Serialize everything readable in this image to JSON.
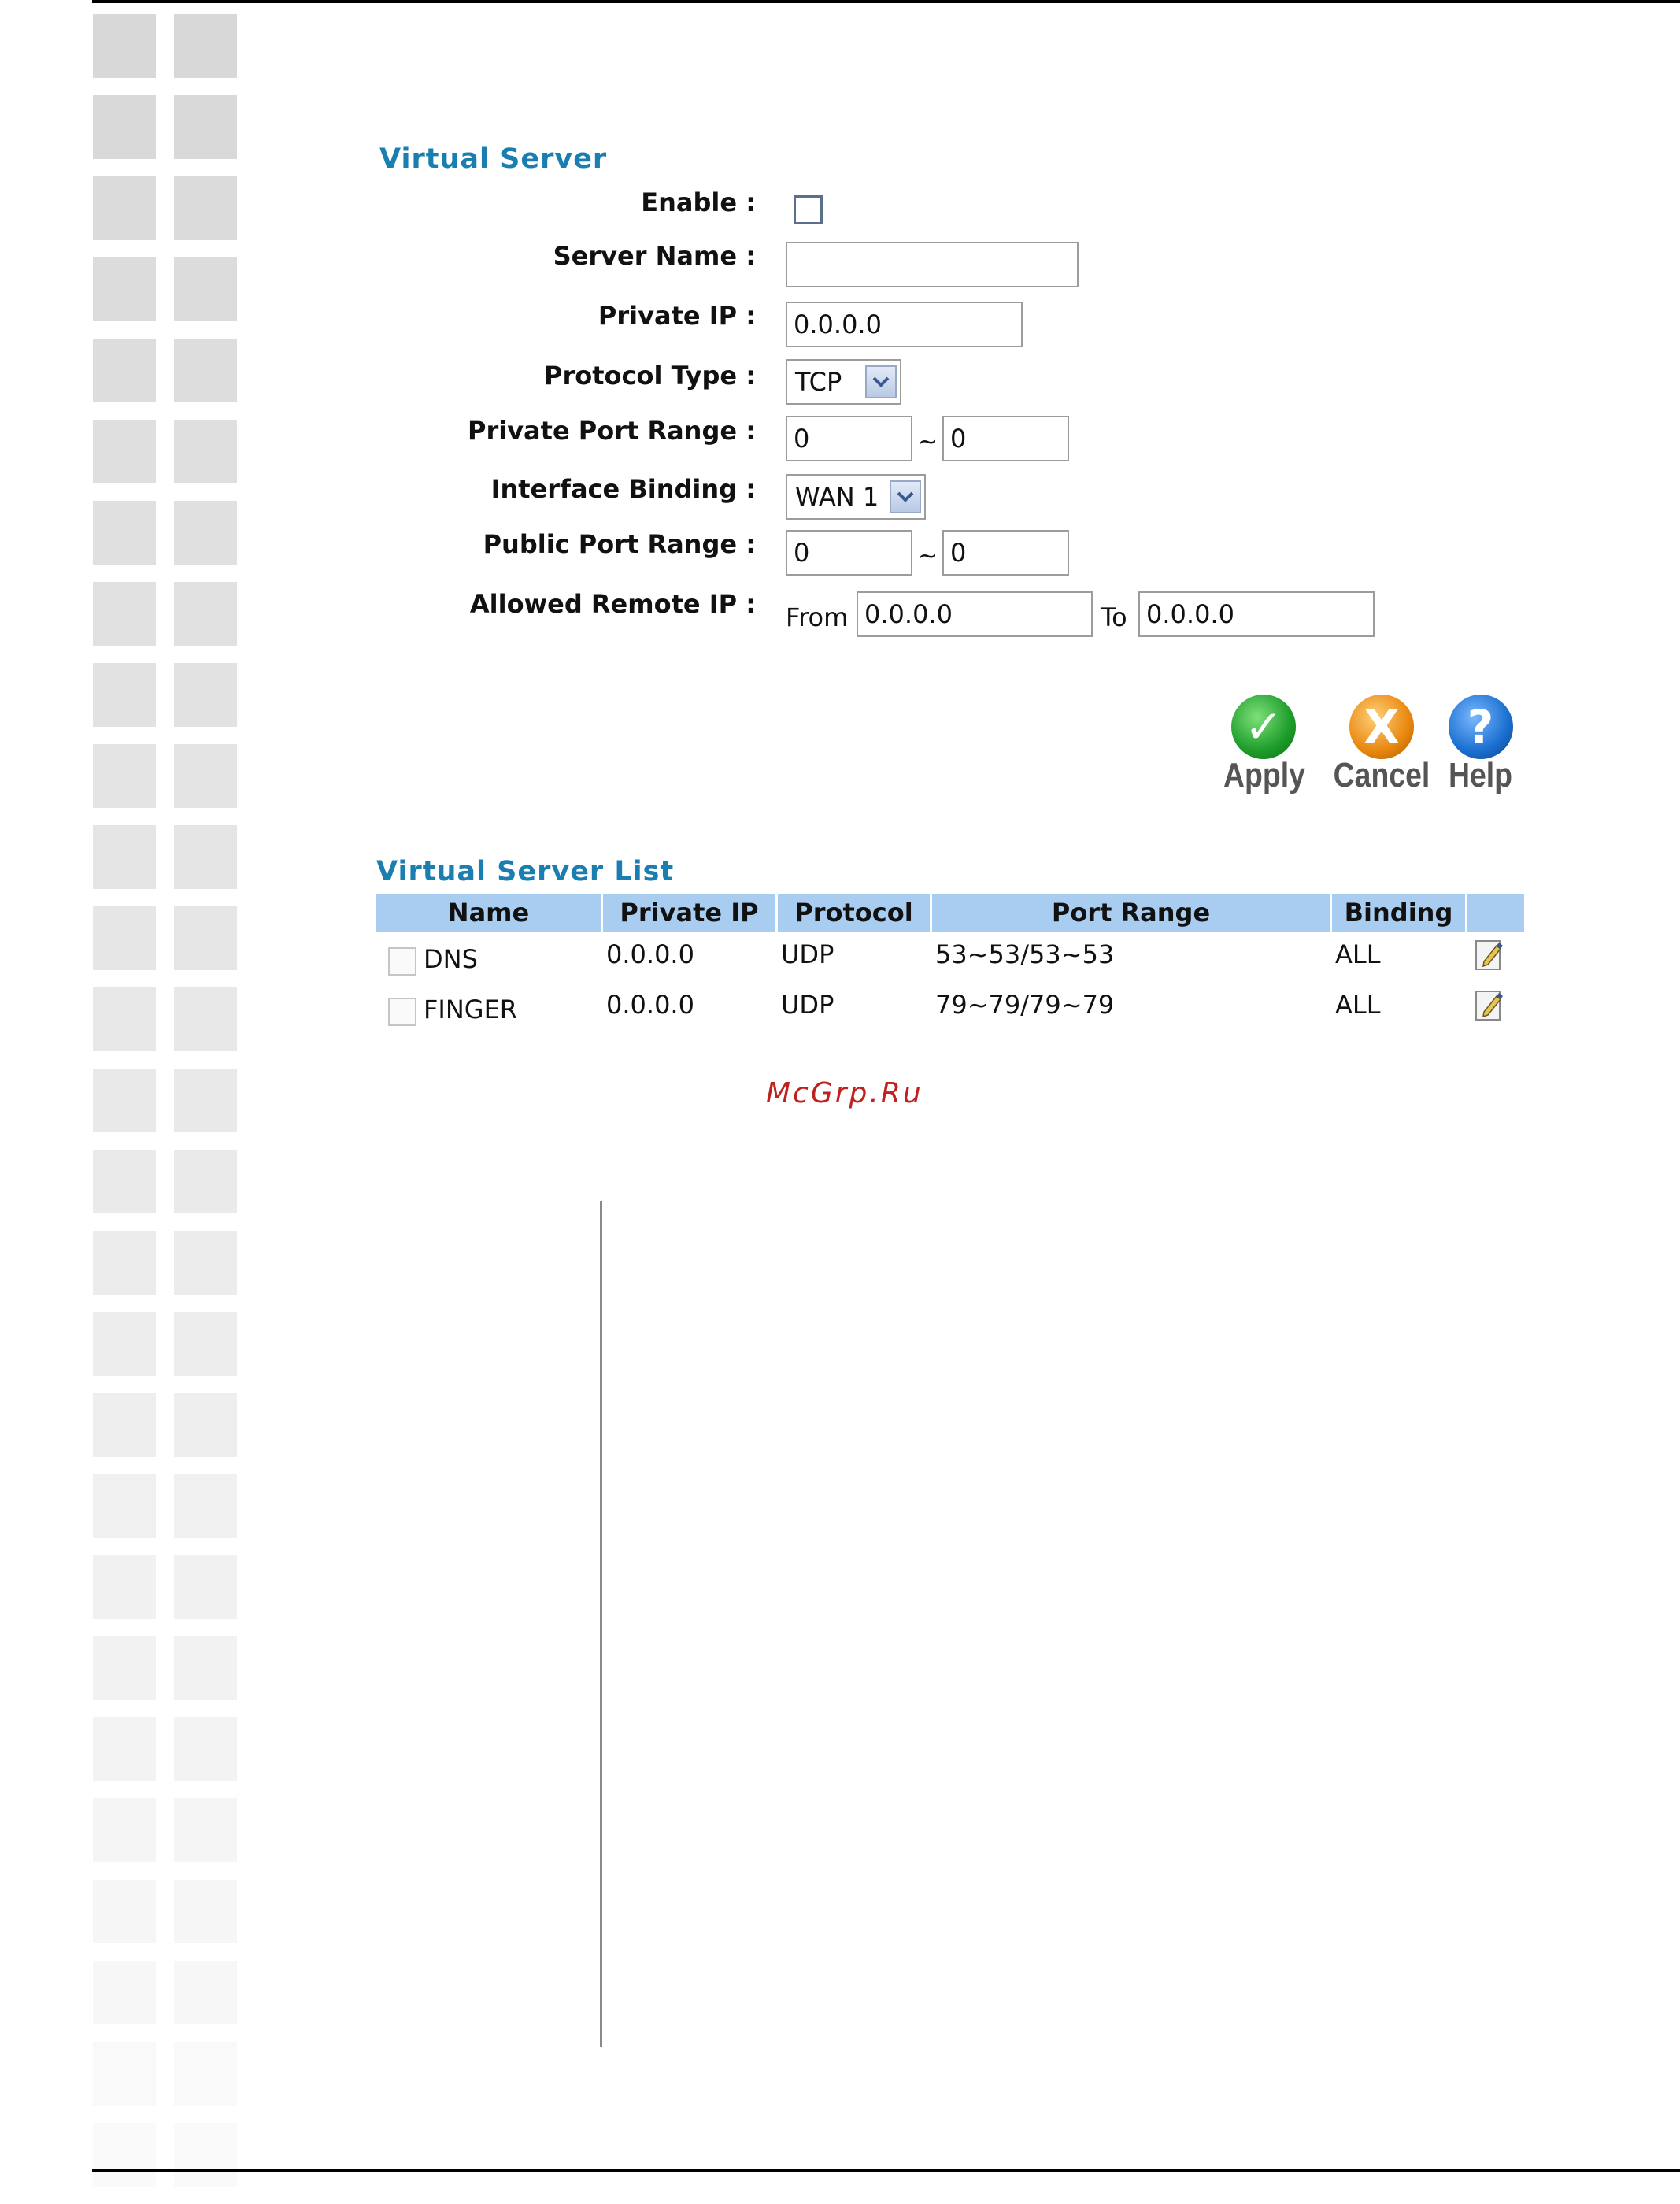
{
  "virtual_server": {
    "title": "Virtual Server",
    "enable_label": "Enable :",
    "server_name_label": "Server Name :",
    "server_name_value": "",
    "private_ip_label": "Private IP :",
    "private_ip_value": "0.0.0.0",
    "protocol_type_label": "Protocol Type :",
    "protocol_type_value": "TCP",
    "private_port_range_label": "Private Port Range :",
    "private_port_start": "0",
    "private_port_end": "0",
    "range_sep": "~",
    "interface_binding_label": "Interface Binding :",
    "interface_binding_value": "WAN 1",
    "public_port_range_label": "Public Port Range :",
    "public_port_start": "0",
    "public_port_end": "0",
    "allowed_remote_ip_label": "Allowed Remote IP :",
    "from_label": "From",
    "from_value": "0.0.0.0",
    "to_label": "To",
    "to_value": "0.0.0.0"
  },
  "actions": {
    "apply": "Apply",
    "cancel": "Cancel",
    "help": "Help",
    "apply_symbol": "✓",
    "cancel_symbol": "X",
    "help_symbol": "?"
  },
  "server_list": {
    "title": "Virtual Server List",
    "columns": [
      "Name",
      "Private IP",
      "Protocol",
      "Port Range",
      "Binding"
    ],
    "rows": [
      {
        "name": "DNS",
        "private_ip": "0.0.0.0",
        "protocol": "UDP",
        "port_range": "53~53/53~53",
        "binding": "ALL"
      },
      {
        "name": "FINGER",
        "private_ip": "0.0.0.0",
        "protocol": "UDP",
        "port_range": "79~79/79~79",
        "binding": "ALL"
      }
    ]
  },
  "watermark": "McGrp.Ru",
  "colors": {
    "section_title": "#1a7fb0",
    "table_header": "#a9cdf0",
    "watermark": "#c0201f"
  }
}
